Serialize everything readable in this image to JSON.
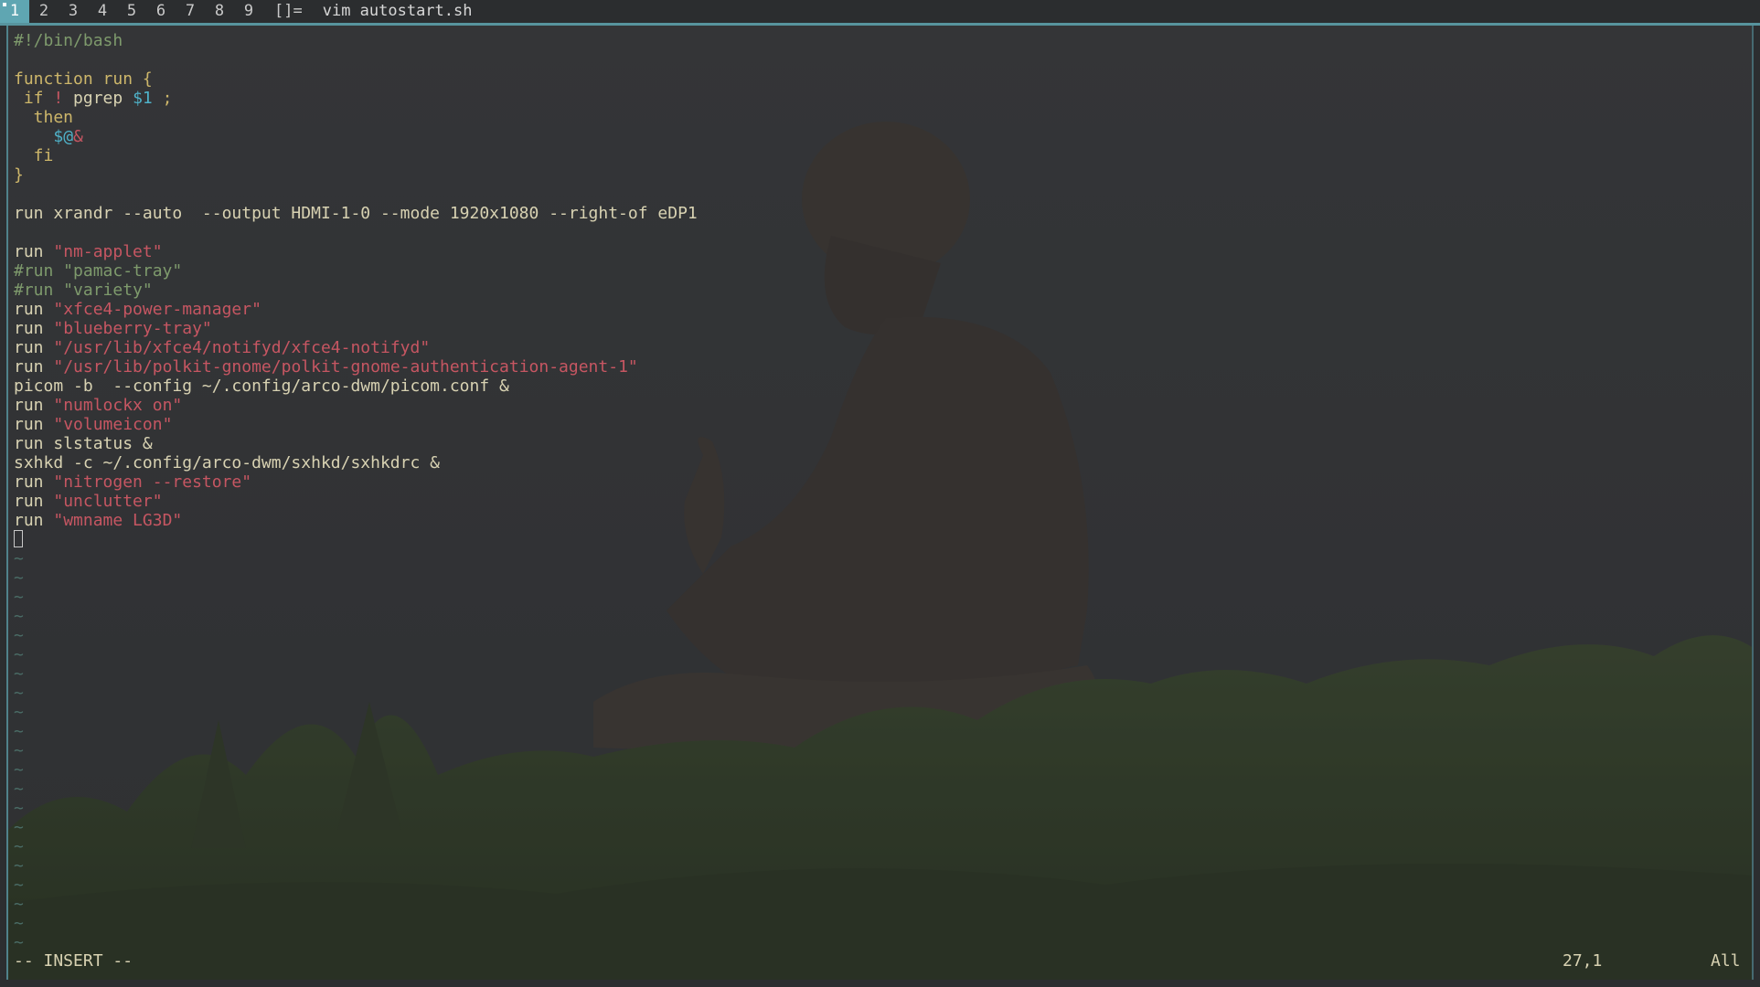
{
  "bar": {
    "tags": [
      {
        "label": "1",
        "active": true
      },
      {
        "label": "2",
        "active": false
      },
      {
        "label": "3",
        "active": false
      },
      {
        "label": "4",
        "active": false
      },
      {
        "label": "5",
        "active": false
      },
      {
        "label": "6",
        "active": false
      },
      {
        "label": "7",
        "active": false
      },
      {
        "label": "8",
        "active": false
      },
      {
        "label": "9",
        "active": false
      }
    ],
    "layout_symbol": "[]=",
    "window_title": "vim autostart.sh",
    "accent_color": "#5fa6b2"
  },
  "editor": {
    "lines": [
      [
        {
          "t": "#!/bin/bash",
          "c": "com"
        }
      ],
      [],
      [
        {
          "t": "function run {",
          "c": "kw"
        }
      ],
      [
        {
          "t": " if",
          "c": "kw"
        },
        {
          "t": " ",
          "c": ""
        },
        {
          "t": "!",
          "c": "str"
        },
        {
          "t": " pgrep ",
          "c": ""
        },
        {
          "t": "$1",
          "c": "var"
        },
        {
          "t": " ;",
          "c": "kw"
        }
      ],
      [
        {
          "t": "  then",
          "c": "kw"
        }
      ],
      [
        {
          "t": "    ",
          "c": ""
        },
        {
          "t": "$@",
          "c": "var"
        },
        {
          "t": "&",
          "c": "str"
        }
      ],
      [
        {
          "t": "  fi",
          "c": "kw"
        }
      ],
      [
        {
          "t": "}",
          "c": "kw"
        }
      ],
      [],
      [
        {
          "t": "run xrandr --auto  --output HDMI-1-0 --mode 1920x1080 --right-of eDP1",
          "c": ""
        }
      ],
      [],
      [
        {
          "t": "run ",
          "c": ""
        },
        {
          "t": "\"nm-applet\"",
          "c": "str"
        }
      ],
      [
        {
          "t": "#run \"pamac-tray\"",
          "c": "com"
        }
      ],
      [
        {
          "t": "#run \"variety\"",
          "c": "com"
        }
      ],
      [
        {
          "t": "run ",
          "c": ""
        },
        {
          "t": "\"xfce4-power-manager\"",
          "c": "str"
        }
      ],
      [
        {
          "t": "run ",
          "c": ""
        },
        {
          "t": "\"blueberry-tray\"",
          "c": "str"
        }
      ],
      [
        {
          "t": "run ",
          "c": ""
        },
        {
          "t": "\"/usr/lib/xfce4/notifyd/xfce4-notifyd\"",
          "c": "str"
        }
      ],
      [
        {
          "t": "run ",
          "c": ""
        },
        {
          "t": "\"/usr/lib/polkit-gnome/polkit-gnome-authentication-agent-1\"",
          "c": "str"
        }
      ],
      [
        {
          "t": "picom -b  --config ~/.config/arco-dwm/picom.conf &",
          "c": ""
        }
      ],
      [
        {
          "t": "run ",
          "c": ""
        },
        {
          "t": "\"numlockx on\"",
          "c": "str"
        }
      ],
      [
        {
          "t": "run ",
          "c": ""
        },
        {
          "t": "\"volumeicon\"",
          "c": "str"
        }
      ],
      [
        {
          "t": "run slstatus &",
          "c": ""
        }
      ],
      [
        {
          "t": "sxhkd -c ~/.config/arco-dwm/sxhkd/sxhkdrc &",
          "c": ""
        }
      ],
      [
        {
          "t": "run ",
          "c": ""
        },
        {
          "t": "\"nitrogen --restore\"",
          "c": "str"
        }
      ],
      [
        {
          "t": "run ",
          "c": ""
        },
        {
          "t": "\"unclutter\"",
          "c": "str"
        }
      ],
      [
        {
          "t": "run ",
          "c": ""
        },
        {
          "t": "\"wmname LG3D\"",
          "c": "str"
        }
      ]
    ],
    "empty_line_marker": "~",
    "empty_line_count": 21,
    "mode": "-- INSERT --",
    "cursor_position": "27,1",
    "scroll_position": "All"
  }
}
